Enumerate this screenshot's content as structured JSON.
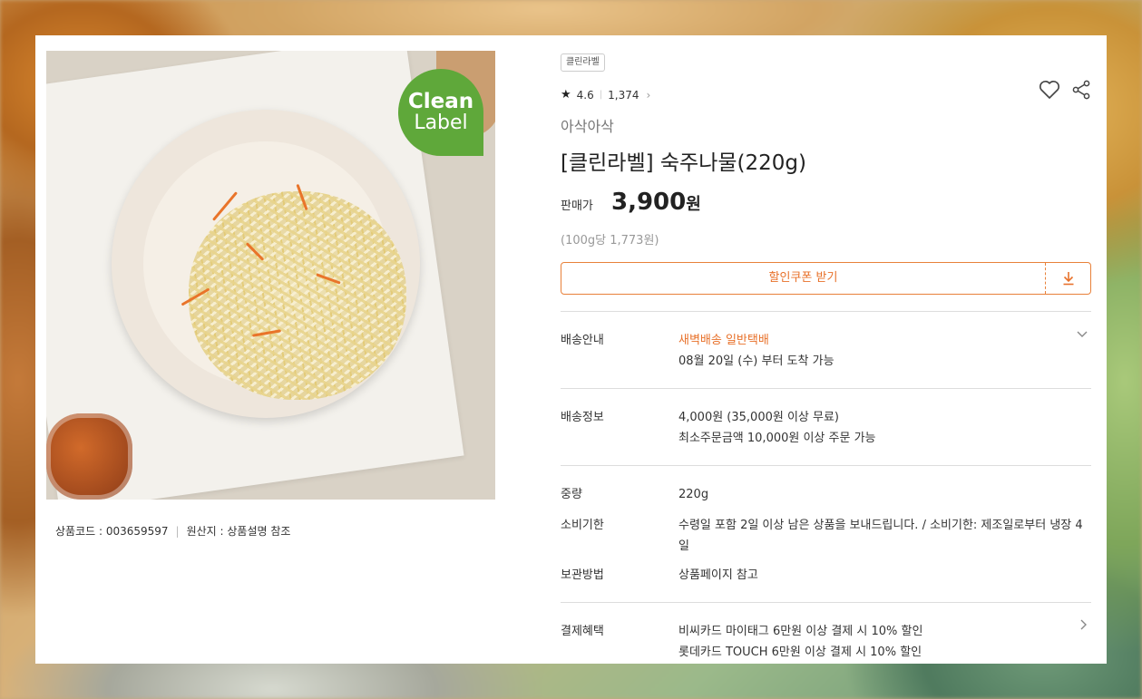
{
  "product": {
    "badge_line1": "Clean",
    "badge_line2": "Label",
    "code": "상품코드 : 003659597",
    "origin": "원산지 : 상품설명 참조",
    "tag": "클린라벨",
    "rating": "4.6",
    "review_count": "1,374",
    "brand": "아삭아삭",
    "title": "[클린라벨] 숙주나물(220g)",
    "price_label": "판매가",
    "price": "3,900",
    "price_unit": "원",
    "unit_price": "(100g당 1,773원)",
    "coupon_label": "할인쿠폰 받기"
  },
  "delivery": {
    "label": "배송안내",
    "methods": "새벽배송 일반택배",
    "eta": "08월 20일 (수) 부터 도착 가능"
  },
  "shipping": {
    "label": "배송정보",
    "fee": "4,000원 (35,000원 이상 무료)",
    "minimum": "최소주문금액 10,000원 이상 주문 가능"
  },
  "details": {
    "weight_label": "중량",
    "weight": "220g",
    "expiry_label": "소비기한",
    "expiry": "수령일 포함 2일 이상 남은 상품을 보내드립니다. / 소비기한: 제조일로부터 냉장 4일",
    "storage_label": "보관방법",
    "storage": "상품페이지 참고"
  },
  "payment": {
    "label": "결제혜택",
    "benefit1": "비씨카드 마이태그 6만원 이상 결제 시 10% 할인",
    "benefit2": "롯데카드 TOUCH 6만원 이상 결제 시 10% 할인"
  },
  "colors": {
    "accent": "#e8712a",
    "badge_green": "#5fa83a"
  },
  "icons": [
    "star-icon",
    "chevron-right-icon",
    "heart-icon",
    "share-icon",
    "download-icon",
    "chevron-down-icon"
  ]
}
